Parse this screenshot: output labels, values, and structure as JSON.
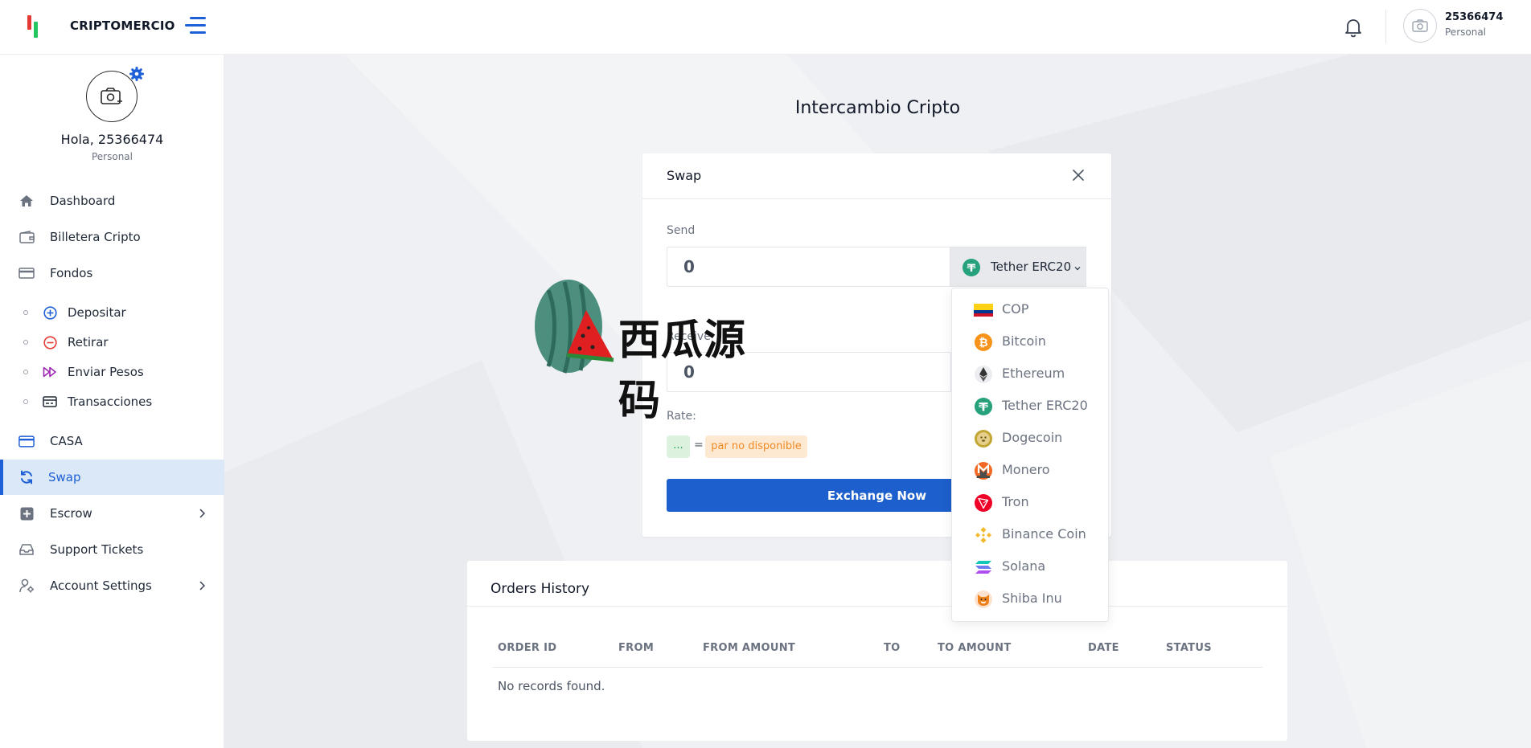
{
  "header": {
    "brand": "CRIPTOMERCIO",
    "username": "25366474",
    "role": "Personal"
  },
  "sidebar": {
    "greeting": "Hola, 25366474",
    "role": "Personal",
    "items": [
      {
        "label": "Dashboard",
        "icon": "home-icon"
      },
      {
        "label": "Billetera Cripto",
        "icon": "wallet-icon"
      },
      {
        "label": "Fondos",
        "icon": "card-icon"
      }
    ],
    "subitems": [
      {
        "label": "Depositar",
        "icon": "plus-circle-icon"
      },
      {
        "label": "Retirar",
        "icon": "minus-circle-icon"
      },
      {
        "label": "Enviar Pesos",
        "icon": "fast-forward-icon"
      },
      {
        "label": "Transacciones",
        "icon": "receipt-icon"
      }
    ],
    "items2": [
      {
        "label": "CASA",
        "icon": "credit-card-icon"
      },
      {
        "label": "Swap",
        "icon": "refresh-icon",
        "active": true
      },
      {
        "label": "Escrow",
        "icon": "plus-square-icon"
      },
      {
        "label": "Support Tickets",
        "icon": "inbox-icon"
      },
      {
        "label": "Account Settings",
        "icon": "user-gear-icon"
      }
    ]
  },
  "page": {
    "title": "Intercambio Cripto"
  },
  "swap": {
    "title": "Swap",
    "send_label": "Send",
    "send_value": "0",
    "receive_label": "Receive",
    "receive_value": "0",
    "selected_coin": "Tether ERC20",
    "rate_label": "Rate:",
    "rate_from": "...",
    "rate_eq": "=",
    "rate_to": "par no disponible",
    "button": "Exchange Now"
  },
  "dropdown": {
    "options": [
      "COP",
      "Bitcoin",
      "Ethereum",
      "Tether ERC20",
      "Dogecoin",
      "Monero",
      "Tron",
      "Binance Coin",
      "Solana",
      "Shiba Inu"
    ]
  },
  "orders": {
    "title": "Orders History",
    "columns": [
      "ORDER ID",
      "FROM",
      "FROM AMOUNT",
      "TO",
      "TO AMOUNT",
      "DATE",
      "STATUS"
    ],
    "empty": "No records found."
  },
  "watermark": {
    "text": "西瓜源码"
  },
  "colors": {
    "accent": "#1d5fd6",
    "active_bg": "#dbe8f7",
    "tether": "#26a17b",
    "bitcoin": "#f7931a",
    "dogecoin": "#c2a633",
    "monero": "#f26822",
    "tron": "#ef0027",
    "binance": "#f3ba2f",
    "rate_ok": "#22a050",
    "rate_warn": "#f08a24"
  }
}
